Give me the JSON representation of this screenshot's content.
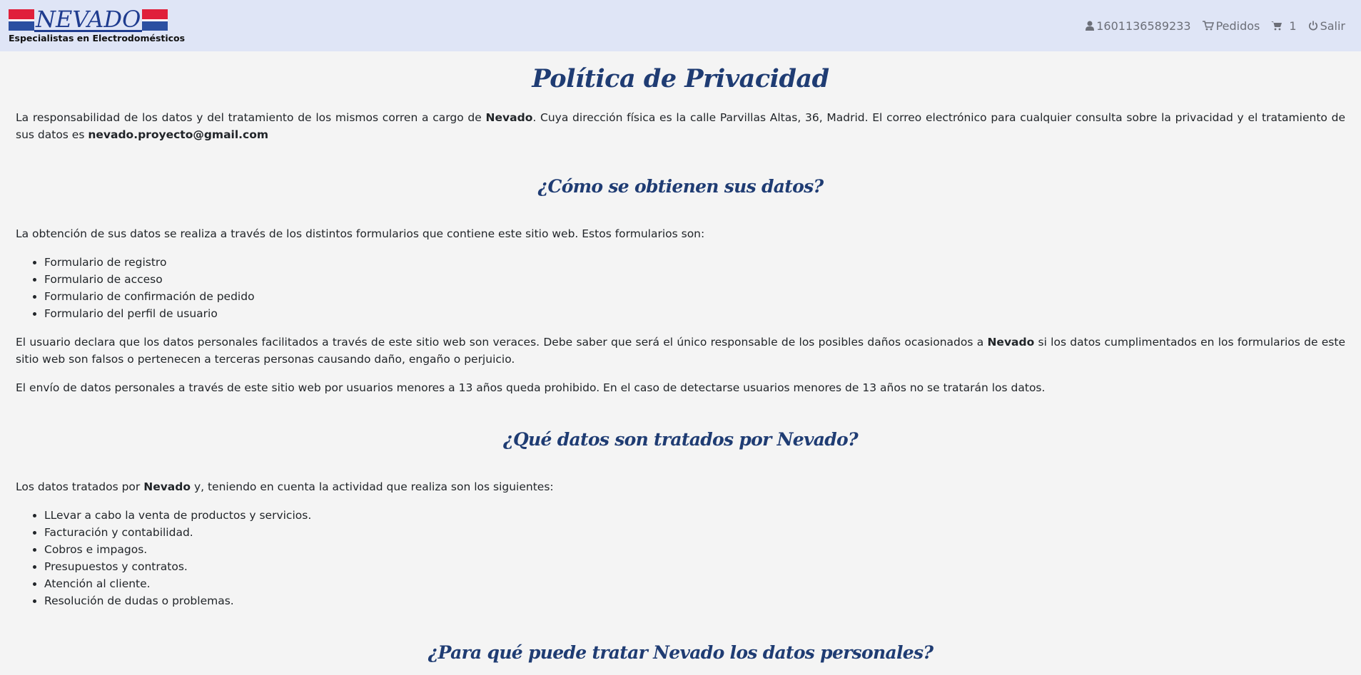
{
  "header": {
    "logo_word": "NEVADO",
    "logo_tagline": "Especialistas en Electrodomésticos",
    "user_id": "1601136589233",
    "orders_label": "Pedidos",
    "cart_count": "1",
    "logout_label": "Salir"
  },
  "page": {
    "title": "Política de Privacidad",
    "intro": {
      "part1": "La responsabilidad de los datos y del tratamiento de los mismos corren a cargo de ",
      "company": "Nevado",
      "part2": ". Cuya dirección física es la calle Parvillas Altas, 36, Madrid. El correo electrónico para cualquier consulta sobre la privacidad y el tratamiento de sus datos es ",
      "email": "nevado.proyecto@gmail.com"
    },
    "section1": {
      "heading": "¿Cómo se obtienen sus datos?",
      "lead": "La obtención de sus datos se realiza a través de los distintos formularios que contiene este sitio web. Estos formularios son:",
      "items": [
        "Formulario de registro",
        "Formulario de acceso",
        "Formulario de confirmación de pedido",
        "Formulario del perfil de usuario"
      ],
      "para2_part1": "El usuario declara que los datos personales facilitados a través de este sitio web son veraces. Debe saber que será el único responsable de los posibles daños ocasionados a ",
      "para2_company": "Nevado",
      "para2_part2": " si los datos cumplimentados en los formularios de este sitio web son falsos o pertenecen a terceras personas causando daño, engaño o perjuicio.",
      "para3": "El envío de datos personales a través de este sitio web por usuarios menores a 13 años queda prohibido. En el caso de detectarse usuarios menores de 13 años no se tratarán los datos."
    },
    "section2": {
      "heading": "¿Qué datos son tratados por Nevado?",
      "lead_part1": "Los datos tratados por ",
      "lead_company": "Nevado",
      "lead_part2": " y, teniendo en cuenta la actividad que realiza son los siguientes:",
      "items": [
        "LLevar a cabo la venta de productos y servicios.",
        "Facturación y contabilidad.",
        "Cobros e impagos.",
        "Presupuestos y contratos.",
        "Atención al cliente.",
        "Resolución de dudas o problemas."
      ]
    },
    "section3": {
      "heading": "¿Para qué puede tratar Nevado los datos personales?"
    }
  },
  "colors": {
    "navbar_bg": "#dfe5f6",
    "heading": "#1f3c73",
    "brand_red": "#e0203b",
    "brand_blue": "#2b4fa1"
  },
  "icons": [
    "user-icon",
    "orders-cart-icon",
    "cart-icon",
    "power-icon"
  ]
}
